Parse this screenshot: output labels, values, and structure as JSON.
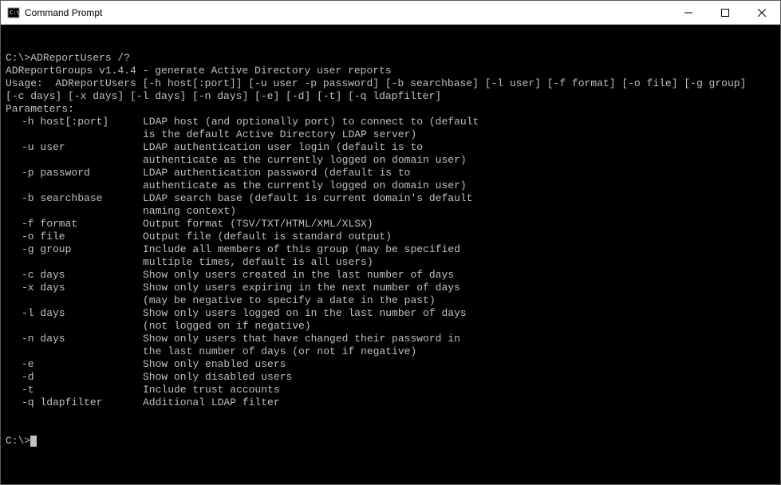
{
  "window": {
    "title": "Command Prompt"
  },
  "terminal": {
    "prompt": "C:\\>",
    "command": "ADReportUsers /?",
    "header1": "ADReportGroups v1.4.4 - generate Active Directory user reports",
    "usage1": "Usage:  ADReportUsers [-h host[:port]] [-u user -p password] [-b searchbase] [-l user] [-f format] [-o file] [-g group]",
    "usage2": "[-c days] [-x days] [-l days] [-n days] [-e] [-d] [-t] [-q ldapfilter]",
    "params_label": "Parameters:",
    "params": [
      {
        "flag": "-h host[:port]",
        "desc": "LDAP host (and optionally port) to connect to (default",
        "cont": [
          "is the default Active Directory LDAP server)"
        ]
      },
      {
        "flag": "-u user",
        "desc": "LDAP authentication user login (default is to",
        "cont": [
          "authenticate as the currently logged on domain user)"
        ]
      },
      {
        "flag": "-p password",
        "desc": "LDAP authentication password (default is to",
        "cont": [
          "authenticate as the currently logged on domain user)"
        ]
      },
      {
        "flag": "-b searchbase",
        "desc": "LDAP search base (default is current domain's default",
        "cont": [
          "naming context)"
        ]
      },
      {
        "flag": "-f format",
        "desc": "Output format (TSV/TXT/HTML/XML/XLSX)",
        "cont": []
      },
      {
        "flag": "-o file",
        "desc": "Output file (default is standard output)",
        "cont": []
      },
      {
        "flag": "-g group",
        "desc": "Include all members of this group (may be specified",
        "cont": [
          "multiple times, default is all users)"
        ]
      },
      {
        "flag": "-c days",
        "desc": "Show only users created in the last number of days",
        "cont": []
      },
      {
        "flag": "-x days",
        "desc": "Show only users expiring in the next number of days",
        "cont": [
          "(may be negative to specify a date in the past)"
        ]
      },
      {
        "flag": "-l days",
        "desc": "Show only users logged on in the last number of days",
        "cont": [
          "(not logged on if negative)"
        ]
      },
      {
        "flag": "-n days",
        "desc": "Show only users that have changed their password in",
        "cont": [
          "the last number of days (or not if negative)"
        ]
      },
      {
        "flag": "-e",
        "desc": "Show only enabled users",
        "cont": []
      },
      {
        "flag": "-d",
        "desc": "Show only disabled users",
        "cont": []
      },
      {
        "flag": "-t",
        "desc": "Include trust accounts",
        "cont": []
      },
      {
        "flag": "-q ldapfilter",
        "desc": "Additional LDAP filter",
        "cont": []
      }
    ],
    "prompt_end": "C:\\>"
  }
}
